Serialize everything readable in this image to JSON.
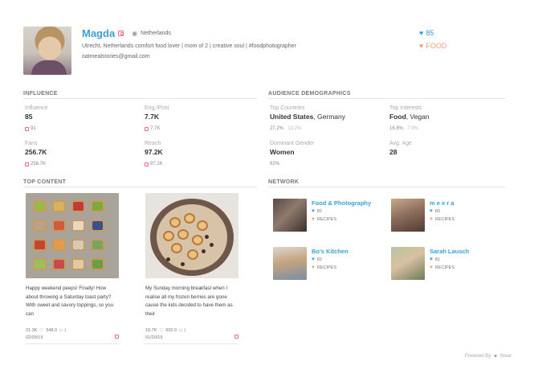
{
  "profile": {
    "name": "Magda",
    "location": "Netherlands",
    "bio": "Utrecht, Netherlands comfort food lover | mom of 2 | creative soul | #foodphotographer",
    "email": "oatmealstories@gmail.com",
    "score": "85",
    "category": "FOOD"
  },
  "influence": {
    "title": "INFLUENCE",
    "stats": [
      {
        "label": "Influence",
        "value": "85",
        "sub": "91"
      },
      {
        "label": "Eng./Post",
        "value": "7.7K",
        "sub": "7.7K"
      },
      {
        "label": "Fans",
        "value": "256.7K",
        "sub": "256.7K"
      },
      {
        "label": "Reach",
        "value": "97.2K",
        "sub": "97.2K"
      }
    ]
  },
  "audience": {
    "title": "AUDIENCE DEMOGRAPHICS",
    "top_countries": {
      "label": "Top Countries",
      "primary": "United States",
      "secondary": ", Germany",
      "pct1": "27.2%",
      "pct2": ", 13.2%"
    },
    "top_interests": {
      "label": "Top Interests",
      "primary": "Food",
      "secondary": ", Vegan",
      "pct1": "16.8%",
      "pct2": ", 7.9%"
    },
    "dominant_gender": {
      "label": "Dominant Gender",
      "value": "Women",
      "pct": "92%"
    },
    "avg_age": {
      "label": "Avg. Age",
      "value": "28"
    }
  },
  "top_content": {
    "title": "TOP CONTENT",
    "posts": [
      {
        "caption": "Happy weekend peeps!    Finally! How about throwing a Saturday toast party? With sweet and savory toppings, so you can",
        "likes": "21.3K",
        "comments": "548.0",
        "date": "02/09/19"
      },
      {
        "caption": "My Sunday morning breakfast when I realise all my frozen berries are gone cause the kids decided to have them as their",
        "likes": "19.7K",
        "comments": "602.0",
        "date": "01/20/19"
      }
    ]
  },
  "network": {
    "title": "NETWORK",
    "items": [
      {
        "name": "Food & Photography",
        "count": "82",
        "category": "RECIPES"
      },
      {
        "name": "m e e r a",
        "count": "80",
        "category": "RECIPES"
      },
      {
        "name": "Bo's Kitchen",
        "count": "82",
        "category": "RECIPES"
      },
      {
        "name": "Sarah Lausch",
        "count": "81",
        "category": "RECIPES"
      }
    ]
  },
  "footer": {
    "powered_by": "Powered By",
    "brand": "Klear"
  },
  "colors": {
    "accent_blue": "#3aa0d5",
    "accent_orange": "#f0a07a",
    "instagram_pink": "#e86a7d"
  },
  "icons": {
    "score": "heart-icon",
    "category": "heart-icon",
    "location": "map-pin-icon",
    "platform": "instagram-icon",
    "likes": "heart-outline-icon",
    "comments": "comment-icon"
  }
}
